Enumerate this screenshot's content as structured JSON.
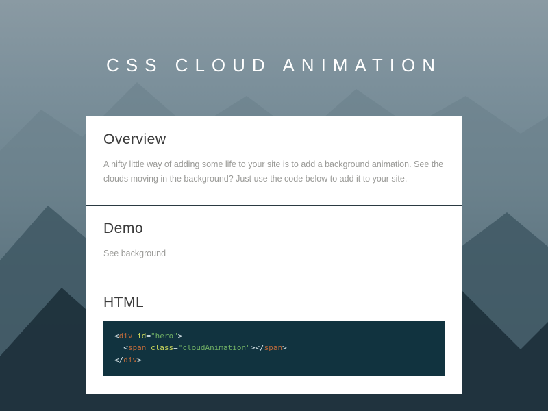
{
  "title": "CSS CLOUD ANIMATION",
  "sections": {
    "overview": {
      "heading": "Overview",
      "body": "A nifty little way of adding some life to your site is to add a background animation. See the clouds moving in the background? Just use the code below to add it to your site."
    },
    "demo": {
      "heading": "Demo",
      "body": "See background"
    },
    "html": {
      "heading": "HTML",
      "code": {
        "outer_tag": "div",
        "outer_attr": "id",
        "outer_val": "hero",
        "inner_tag": "span",
        "inner_attr": "class",
        "inner_val": "cloudAnimation",
        "raw": "<div id=\"hero\">\n  <span class=\"cloudAnimation\"></span>\n</div>"
      }
    }
  }
}
